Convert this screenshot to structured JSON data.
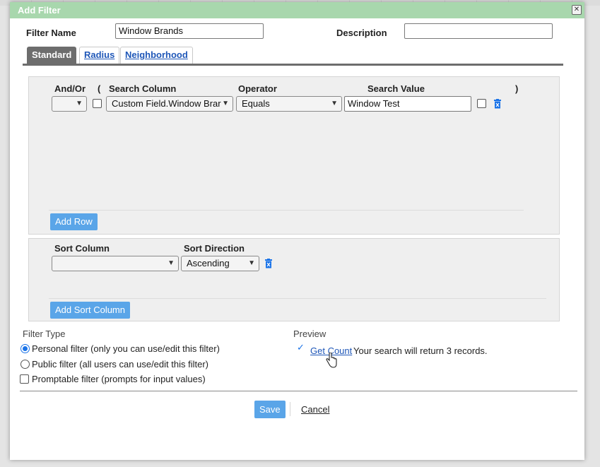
{
  "dialog": {
    "title": "Add Filter"
  },
  "form": {
    "filter_name_label": "Filter Name",
    "filter_name_value": "Window Brands",
    "description_label": "Description",
    "description_value": ""
  },
  "tabs": [
    {
      "label": "Standard",
      "active": true
    },
    {
      "label": "Radius",
      "active": false
    },
    {
      "label": "Neighborhood",
      "active": false
    }
  ],
  "criteria": {
    "headers": {
      "and_or": "And/Or",
      "open_paren": "(",
      "search_column": "Search Column",
      "operator": "Operator",
      "search_value": "Search Value",
      "close_paren": ")"
    },
    "row": {
      "and_or": "",
      "search_column": "Custom Field.Window Brar",
      "operator": "Equals",
      "search_value": "Window Test"
    },
    "add_row_label": "Add Row"
  },
  "sort": {
    "headers": {
      "sort_column": "Sort Column",
      "sort_direction": "Sort Direction"
    },
    "row": {
      "sort_column": "",
      "sort_direction": "Ascending"
    },
    "add_sort_label": "Add Sort Column"
  },
  "filter_type": {
    "title": "Filter Type",
    "options": [
      {
        "label": "Personal filter (only you can use/edit this filter)",
        "selected": true
      },
      {
        "label": "Public filter (all users can use/edit this filter)",
        "selected": false
      }
    ],
    "promptable_label": "Promptable filter (prompts for input values)"
  },
  "preview": {
    "title": "Preview",
    "get_count_label": "Get Count",
    "result_text": "Your search will return 3 records."
  },
  "footer": {
    "save_label": "Save",
    "cancel_label": "Cancel"
  },
  "colors": {
    "title_bar": "#a8d7ad",
    "button_blue": "#5aa5e8",
    "link": "#1f57b8",
    "active_tab": "#6d6d6d",
    "trash_blue": "#1a73e8"
  }
}
